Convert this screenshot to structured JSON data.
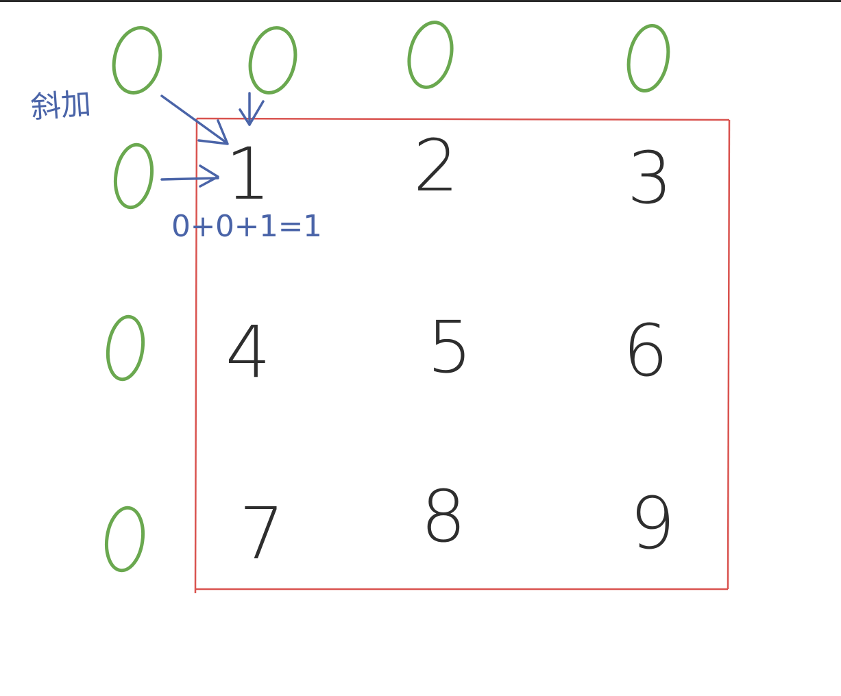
{
  "annotations": {
    "corner_label": "斜加",
    "sum_expression": "0+0+1=1"
  },
  "padding": {
    "top_row": [
      "0",
      "0",
      "0",
      "0"
    ],
    "left_column": [
      "0",
      "0",
      "0"
    ]
  },
  "grid": {
    "rows": [
      [
        "1",
        "2",
        "3"
      ],
      [
        "4",
        "5",
        "6"
      ],
      [
        "7",
        "8",
        "9"
      ]
    ]
  },
  "colors": {
    "grid_border": "#d9534f",
    "digits": "#2e2e2e",
    "padding_zeros": "#6aa84f",
    "annotations": "#4a64a8"
  }
}
